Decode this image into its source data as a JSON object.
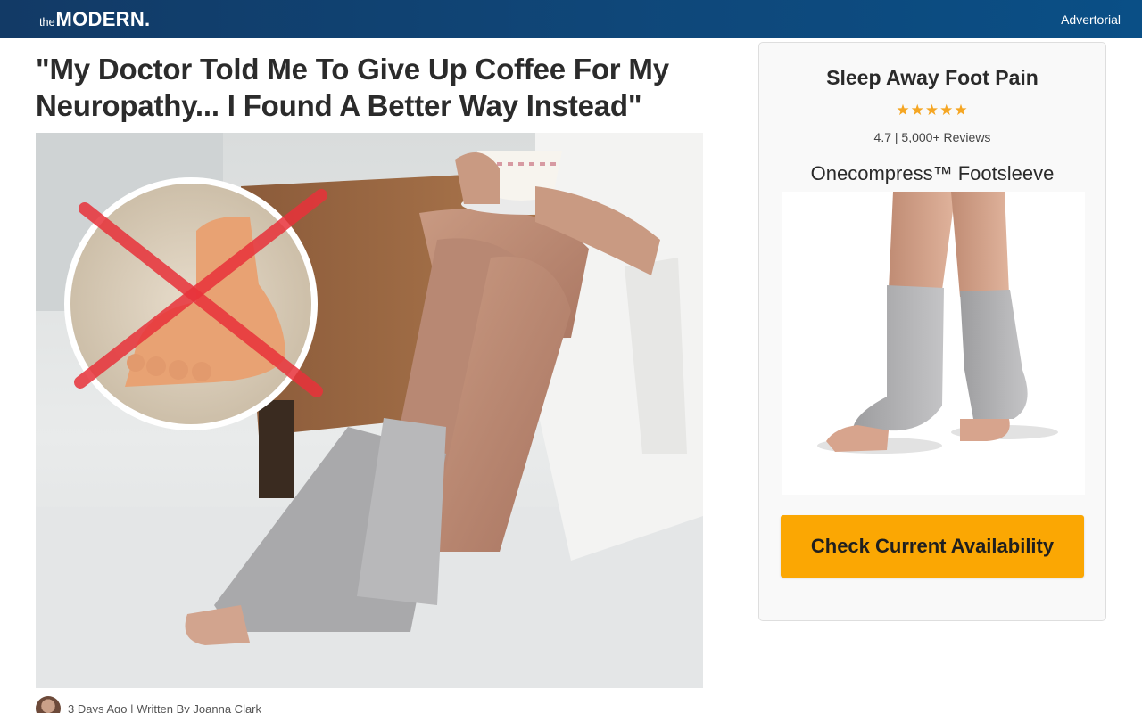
{
  "header": {
    "logo_prefix": "the",
    "logo_main": "MODERN.",
    "advertorial": "Advertorial"
  },
  "article": {
    "headline": "\"My Doctor Told Me To Give Up Coffee For My Neuropathy... I Found A Better Way Instead\"",
    "byline": "3 Days Ago | Written By Joanna Clark"
  },
  "sidebar": {
    "title": "Sleep Away Foot Pain",
    "stars": "★★★★★",
    "rating_text": "4.7 | 5,000+ Reviews",
    "product_name": "Onecompress™ Footsleeve",
    "cta_label": "Check Current Availability"
  },
  "colors": {
    "header_bg": "#0f4779",
    "cta_bg": "#fba703",
    "star": "#f5a623",
    "cross_out": "#e8323a"
  }
}
